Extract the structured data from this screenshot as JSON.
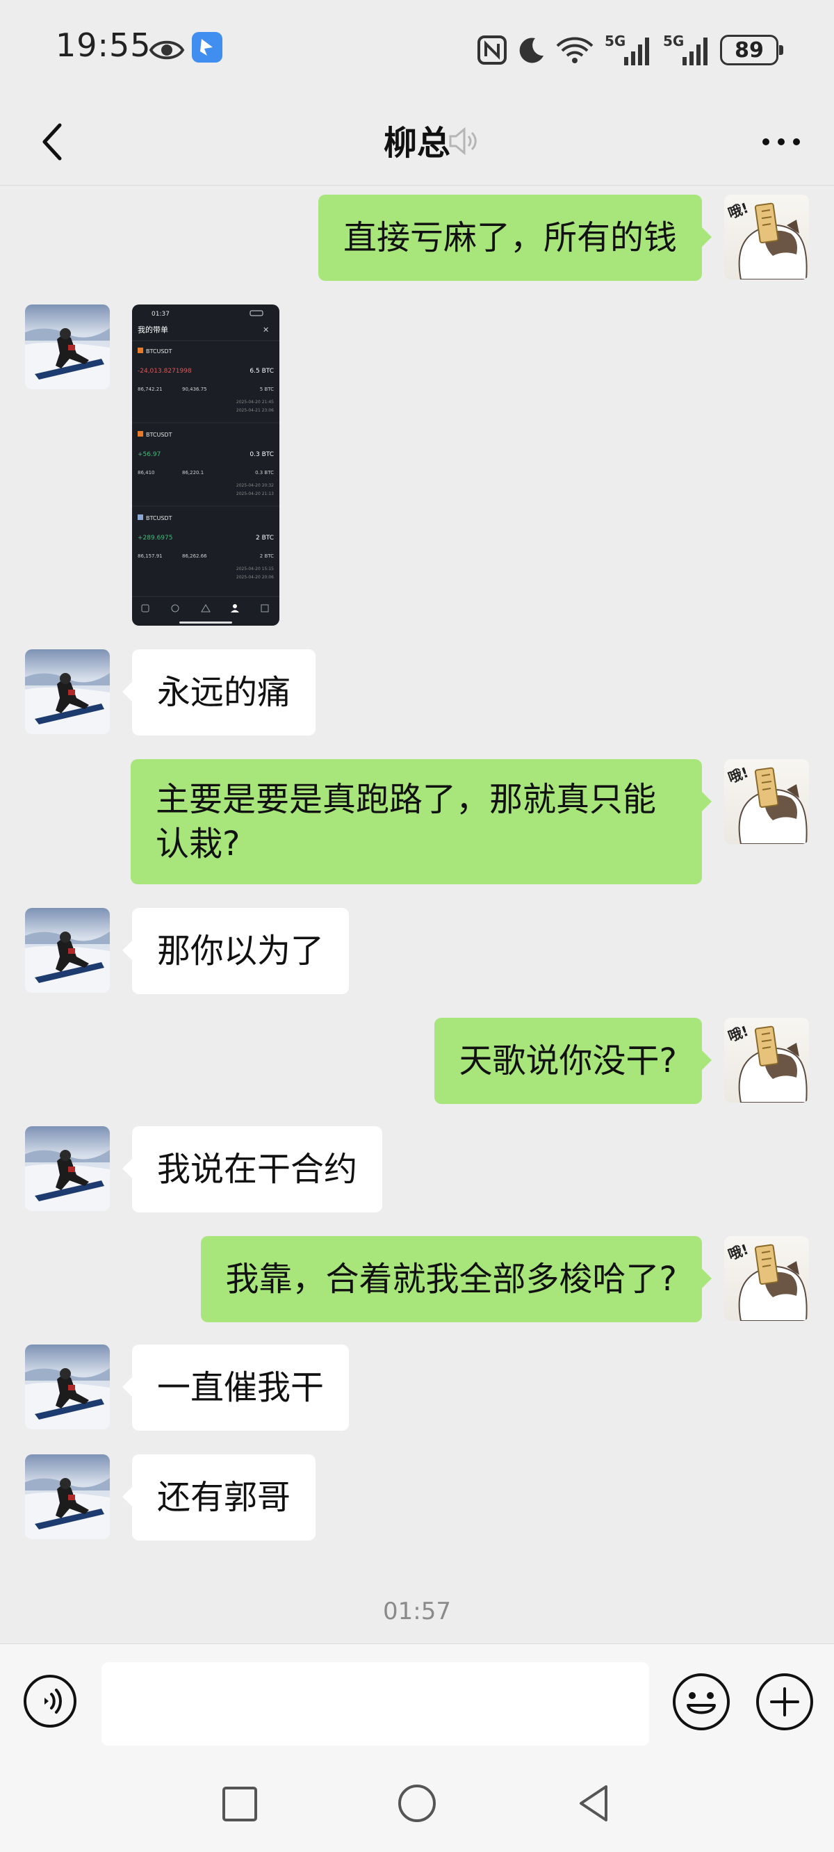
{
  "status_bar": {
    "time": "19:55",
    "battery": "89",
    "icons": [
      "eye-icon",
      "app-notification-icon",
      "nfc-icon",
      "moon-icon",
      "wifi-icon",
      "5g-signal-icon",
      "5g-signal-icon",
      "battery-icon"
    ]
  },
  "header": {
    "title": "柳总",
    "back_icon": "chevron-left-icon",
    "mute_icon": "sound-off-icon",
    "more_icon": "more-dots-icon"
  },
  "messages": [
    {
      "direction": "out",
      "type": "text",
      "text": "直接亏麻了，所有的钱"
    },
    {
      "direction": "in",
      "type": "image",
      "image": {
        "status_time": "01:37",
        "title": "我的带单",
        "orders": [
          {
            "symbol": "BTCUSDT",
            "value": "-24,013.8271998",
            "amount": "6.5 BTC",
            "row1": "86,742.21",
            "row2": "90,436.75",
            "row2b": "5 BTC",
            "date1": "2025-04-20 21:45",
            "date2": "2025-04-21 23:06"
          },
          {
            "symbol": "BTCUSDT",
            "value": "+56.97",
            "amount": "0.3 BTC",
            "row1": "86,410",
            "row2": "86,220.1",
            "row2b": "0.3 BTC",
            "date1": "2025-04-20 20:32",
            "date2": "2025-04-20 21:13"
          },
          {
            "symbol": "BTCUSDT",
            "value": "+289.6975",
            "amount": "2 BTC",
            "row1": "86,157.91",
            "row2": "86,262.66",
            "row2b": "2 BTC",
            "date1": "2025-04-20 15:15",
            "date2": "2025-04-20 20:06"
          }
        ]
      }
    },
    {
      "direction": "in",
      "type": "text",
      "text": "永远的痛"
    },
    {
      "direction": "out",
      "type": "text",
      "text": "主要是要是真跑路了，那就真只能认栽?"
    },
    {
      "direction": "in",
      "type": "text",
      "text": "那你以为了"
    },
    {
      "direction": "out",
      "type": "text",
      "text": "天歌说你没干?"
    },
    {
      "direction": "in",
      "type": "text",
      "text": "我说在干合约"
    },
    {
      "direction": "out",
      "type": "text",
      "text": "我靠，合着就我全部多梭哈了?"
    },
    {
      "direction": "in",
      "type": "text",
      "text": "一直催我干"
    },
    {
      "direction": "in",
      "type": "text",
      "text": "还有郭哥"
    }
  ],
  "timestamp": "01:57",
  "input_bar": {
    "placeholder": "",
    "voice_icon": "voice-icon",
    "emoji_icon": "emoji-icon",
    "plus_icon": "plus-icon"
  },
  "nav_bar": {
    "icons": [
      "recent-apps-icon",
      "home-icon",
      "back-icon"
    ]
  },
  "colors": {
    "background": "#ededed",
    "outgoing_bubble": "#a8e67c",
    "incoming_bubble": "#ffffff"
  }
}
